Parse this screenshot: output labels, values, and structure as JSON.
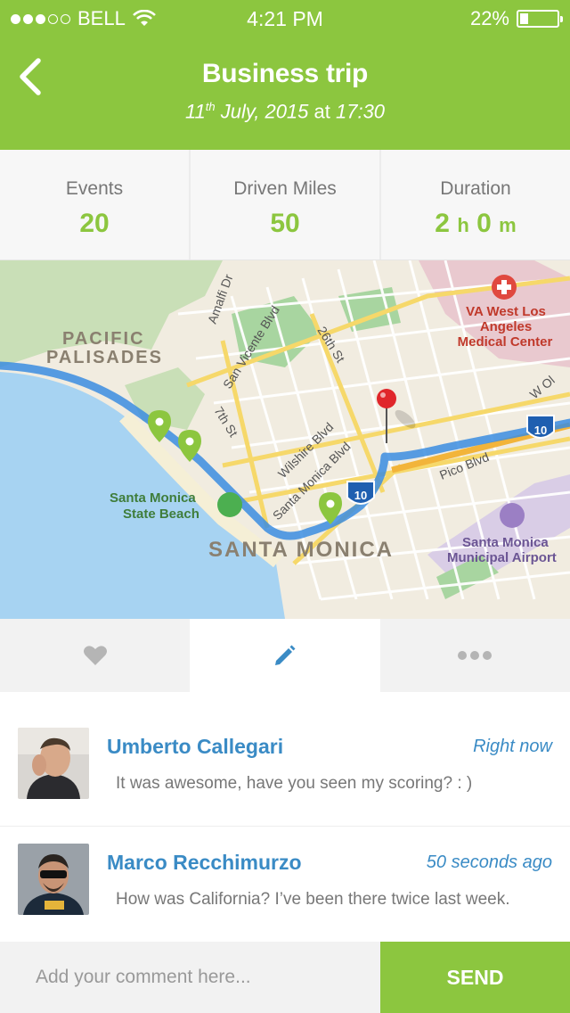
{
  "status_bar": {
    "carrier": "BELL",
    "time": "4:21 PM",
    "battery": "22%",
    "battery_level": 0.22
  },
  "header": {
    "title": "Business trip",
    "date_day": "11",
    "date_suffix": "th",
    "date_rest": " July, 2015",
    "time_prefix": " at ",
    "time": "17:30",
    "back_icon": "chevron-left-icon"
  },
  "stats": [
    {
      "label": "Events",
      "value": "20"
    },
    {
      "label": "Driven Miles",
      "value": "50"
    },
    {
      "label": "Duration",
      "hours": "2",
      "hours_unit": "h",
      "minutes": "0",
      "minutes_unit": "m"
    }
  ],
  "map": {
    "labels": {
      "pacific": "PACIFIC",
      "palisades": "PALISADES",
      "santa_monica": "SANTA MONICA",
      "state_beach_1": "Santa Monica",
      "state_beach_2": "State Beach",
      "va_1": "VA West Los",
      "va_2": "Angeles",
      "va_3": "Medical Center",
      "airport_1": "Santa Monica",
      "airport_2": "Municipal Airport",
      "amalfi": "Amalfi Dr",
      "san_vicente": "San Vicente Blvd",
      "st26": "26th St",
      "st7": "7th St",
      "wilshire": "Wilshire Blvd",
      "sm_blvd": "Santa Monica Blvd",
      "pico": "Pico Blvd",
      "olympic": "W Ol",
      "i10": "10"
    },
    "colors": {
      "water": "#a7d3f2",
      "land": "#f1ece0",
      "park": "#a8d5a0",
      "route": "#3b8de0",
      "pin": "#8cc63f",
      "dest_pin": "#e0262b"
    }
  },
  "tabs": [
    {
      "name": "like",
      "icon": "heart-icon"
    },
    {
      "name": "comment",
      "icon": "pencil-icon"
    },
    {
      "name": "more",
      "icon": "more-icon"
    }
  ],
  "comments": [
    {
      "name": "Umberto Callegari",
      "time": "Right now",
      "text": "It was awesome, have you seen my scoring? : )"
    },
    {
      "name": "Marco Recchimurzo",
      "time": "50 seconds ago",
      "text": "How was California? I’ve been there twice last week."
    }
  ],
  "footer": {
    "placeholder": "Add your comment here...",
    "send_label": "SEND"
  },
  "accent_color": "#8cc63f",
  "link_color": "#3a8bc5"
}
